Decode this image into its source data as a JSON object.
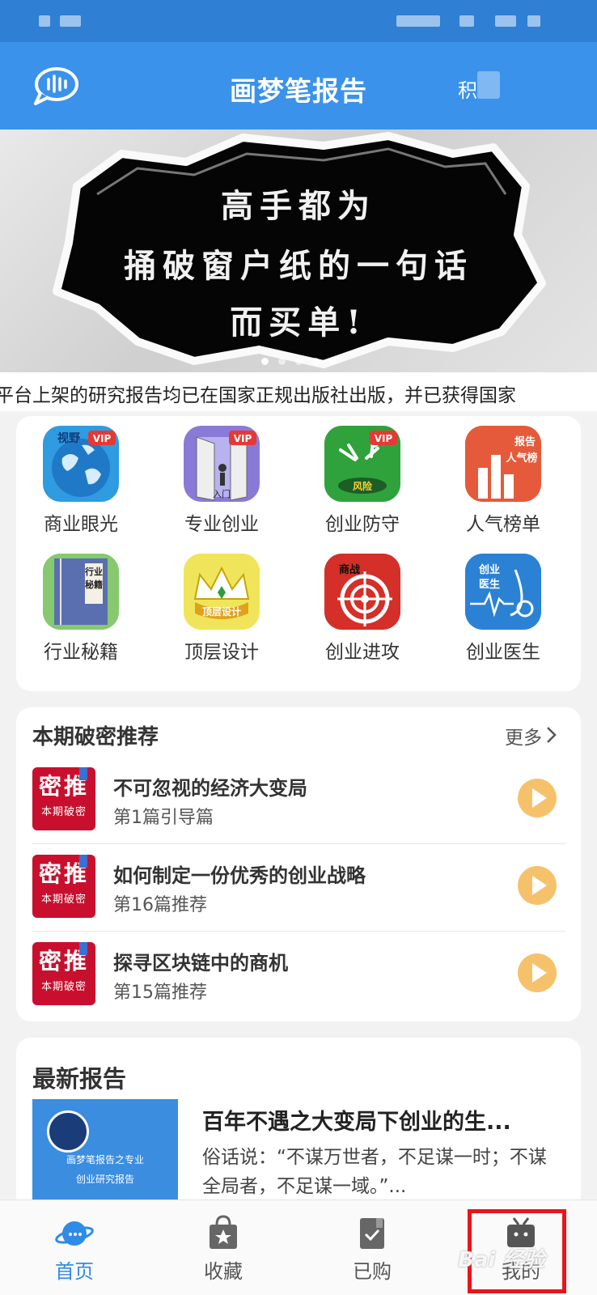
{
  "status_bar": {},
  "app_bar": {
    "title": "画梦笔报告",
    "right_text": "积"
  },
  "banner": {
    "lines": [
      "高手都为",
      "捅破窗户纸的一句话",
      "而买单!"
    ]
  },
  "marquee": {
    "text": "平台上架的研究报告均已在国家正规出版社出版，并已获得国家"
  },
  "grid": {
    "items": [
      {
        "label": "商业眼光",
        "icon": "globe-vip-icon",
        "icon_text": "视野",
        "badge": "VIP"
      },
      {
        "label": "专业创业",
        "icon": "door-vip-icon",
        "icon_text": "入门",
        "badge": "VIP"
      },
      {
        "label": "创业防守",
        "icon": "risk-vip-icon",
        "icon_text": "风险",
        "badge": "VIP"
      },
      {
        "label": "人气榜单",
        "icon": "ranking-icon",
        "icon_text": "报告人气榜"
      },
      {
        "label": "行业秘籍",
        "icon": "book-icon",
        "icon_text": "行业秘籍"
      },
      {
        "label": "顶层设计",
        "icon": "crown-icon",
        "icon_text": "顶层设计"
      },
      {
        "label": "创业进攻",
        "icon": "target-icon",
        "icon_text": "商战"
      },
      {
        "label": "创业医生",
        "icon": "stethoscope-icon",
        "icon_text": "创业医生"
      }
    ]
  },
  "recommend": {
    "title": "本期破密推荐",
    "more": "更多",
    "thumb_big": "密推",
    "thumb_small": "本期破密",
    "items": [
      {
        "name": "不可忽视的经济大变局",
        "sub": "第1篇引导篇"
      },
      {
        "name": "如何制定一份优秀的创业战略",
        "sub": "第16篇推荐"
      },
      {
        "name": "探寻区块链中的商机",
        "sub": "第15篇推荐"
      }
    ]
  },
  "latest": {
    "title": "最新报告",
    "thumb_line1": "画梦笔报告之专业",
    "thumb_line2": "创业研究报告",
    "name": "百年不遇之大变局下创业的生...",
    "desc": "俗话说：“不谋万世者，不足谋一时；不谋全局者，不足谋一域。”..."
  },
  "tabs": [
    {
      "label": "首页",
      "icon": "home-planet-icon"
    },
    {
      "label": "收藏",
      "icon": "favorites-bag-icon"
    },
    {
      "label": "已购",
      "icon": "purchased-icon"
    },
    {
      "label": "我的",
      "icon": "profile-tv-icon"
    }
  ],
  "colors": {
    "primary": "#3a92ea",
    "statusbar": "#2f7fd4",
    "highlight": "#e8161b",
    "play": "#f5c26b",
    "badge_red": "#c8102e"
  },
  "watermark": "Bai 经验"
}
